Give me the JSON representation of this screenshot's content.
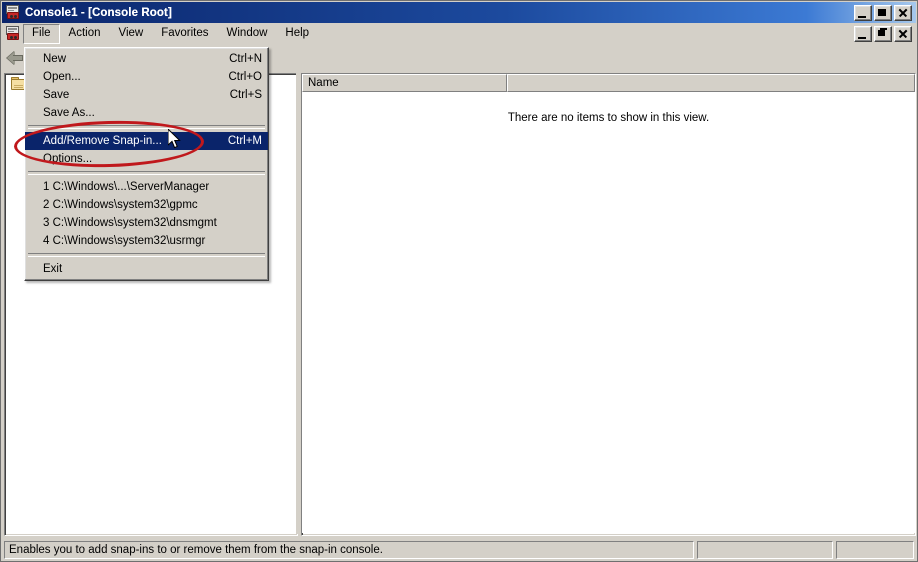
{
  "window": {
    "title": "Console1 - [Console Root]",
    "icon": "mmc-console-icon",
    "buttons": {
      "minimize": "_",
      "maximize": "□",
      "close": "×"
    },
    "mdi_buttons": {
      "minimize": "_",
      "restore": "❐",
      "close": "×"
    }
  },
  "menubar": {
    "items": [
      {
        "label": "File",
        "open": true
      },
      {
        "label": "Action",
        "open": false
      },
      {
        "label": "View",
        "open": false
      },
      {
        "label": "Favorites",
        "open": false
      },
      {
        "label": "Window",
        "open": false
      },
      {
        "label": "Help",
        "open": false
      }
    ]
  },
  "toolbar": {
    "back_icon": "back-arrow-icon"
  },
  "file_menu": {
    "groups": [
      {
        "items": [
          {
            "label": "New",
            "accel": "Ctrl+N",
            "selected": false
          },
          {
            "label": "Open...",
            "accel": "Ctrl+O",
            "selected": false
          },
          {
            "label": "Save",
            "accel": "Ctrl+S",
            "selected": false
          },
          {
            "label": "Save As...",
            "accel": "",
            "selected": false
          }
        ]
      },
      {
        "items": [
          {
            "label": "Add/Remove Snap-in...",
            "accel": "Ctrl+M",
            "selected": true
          },
          {
            "label": "Options...",
            "accel": "",
            "selected": false
          }
        ]
      },
      {
        "items": [
          {
            "label": "1 C:\\Windows\\...\\ServerManager",
            "accel": "",
            "selected": false
          },
          {
            "label": "2 C:\\Windows\\system32\\gpmc",
            "accel": "",
            "selected": false
          },
          {
            "label": "3 C:\\Windows\\system32\\dnsmgmt",
            "accel": "",
            "selected": false
          },
          {
            "label": "4 C:\\Windows\\system32\\usrmgr",
            "accel": "",
            "selected": false
          }
        ]
      },
      {
        "items": [
          {
            "label": "Exit",
            "accel": "",
            "selected": false
          }
        ]
      }
    ]
  },
  "tree": {
    "root_icon": "folder-icon",
    "root_label": ""
  },
  "list_view": {
    "columns": [
      "Name",
      ""
    ],
    "empty_message": "There are no items to show in this view."
  },
  "statusbar": {
    "message": "Enables you to add snap-ins to or remove them from the snap-in console.",
    "pane2": "",
    "pane3": ""
  },
  "annotation": {
    "shape": "red-ellipse-highlight",
    "color": "#c0181c",
    "target": "Add/Remove Snap-in..."
  },
  "cursor": {
    "type": "arrow-pointer"
  }
}
